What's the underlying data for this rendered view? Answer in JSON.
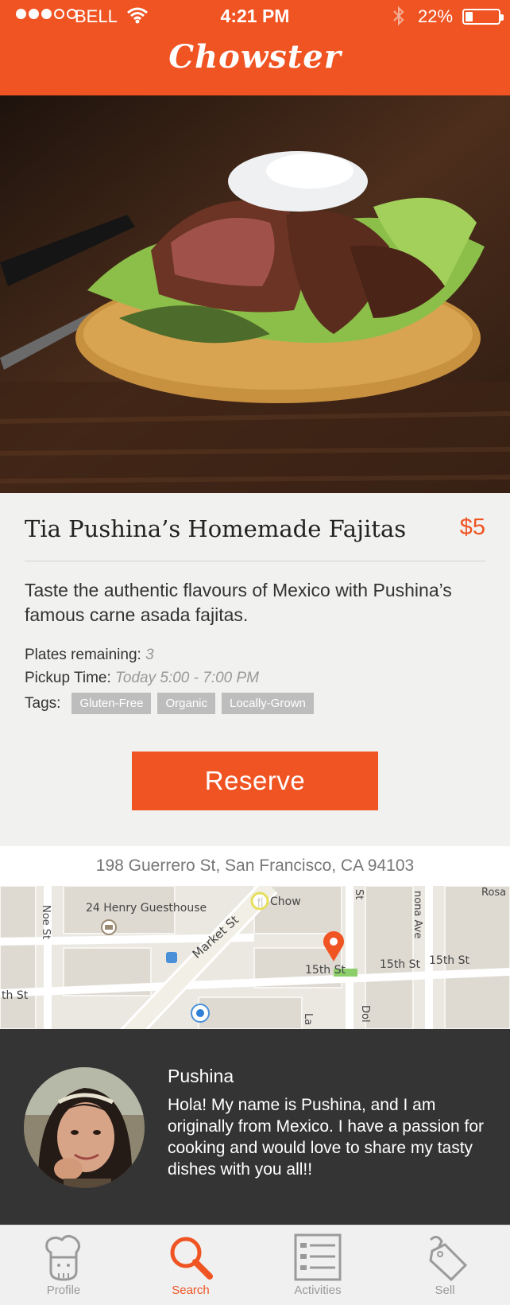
{
  "status_bar": {
    "carrier": "BELL",
    "time": "4:21 PM",
    "battery": "22%",
    "battery_level": 0.22,
    "signal_bars": 3,
    "signal_total": 5
  },
  "header": {
    "app_title": "Chowster"
  },
  "listing": {
    "title": "Tia Pushina’s Homemade Fajitas",
    "price": "$5",
    "description": "Taste the authentic flavours of Mexico with Pushina’s famous carne asada fajitas.",
    "plates_label": "Plates remaining:",
    "plates_value": "3",
    "pickup_label": "Pickup Time:",
    "pickup_value": "Today 5:00 - 7:00 PM",
    "tags_label": "Tags:",
    "tags": [
      "Gluten-Free",
      "Organic",
      "Locally-Grown"
    ],
    "reserve_label": "Reserve"
  },
  "location": {
    "address": "198 Guerrero St, San Francisco, CA 94103",
    "map_labels": {
      "guesthouse": "24 Henry Guesthouse",
      "market": "Market St",
      "noe": "Noe St",
      "chow": "Chow",
      "fifteenth_1": "15th St",
      "fifteenth_2": "15th St",
      "fifteenth_3": "15th St",
      "th_st": "th St",
      "st": "St",
      "nona": "nona Ave",
      "rosa": "Rosa",
      "dol": "Dol",
      "la": "La"
    }
  },
  "seller": {
    "name": "Pushina",
    "bio": "Hola! My name is Pushina, and I am originally from Mexico. I have a passion for cooking and would love to share my tasty dishes with you all!!"
  },
  "tabs": [
    {
      "label": "Profile",
      "icon": "chef-icon",
      "active": false
    },
    {
      "label": "Search",
      "icon": "search-icon",
      "active": true
    },
    {
      "label": "Activities",
      "icon": "activities-icon",
      "active": false
    },
    {
      "label": "Sell",
      "icon": "tag-icon",
      "active": false
    }
  ],
  "colors": {
    "accent": "#f05423",
    "tag_bg": "#bdbdbd",
    "profile_bg": "#343434",
    "inactive_tab": "#9a9a9a"
  }
}
